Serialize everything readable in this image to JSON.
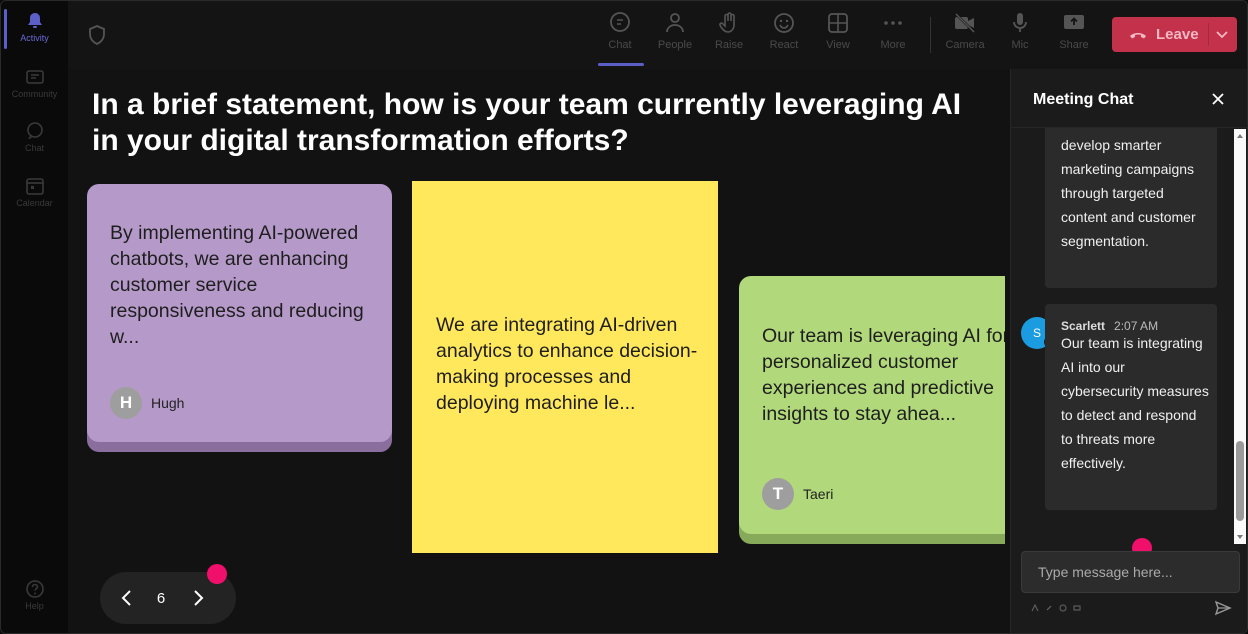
{
  "rail": {
    "items": [
      {
        "label": "Activity",
        "icon": "bell-icon"
      },
      {
        "label": "Community",
        "icon": "community-icon"
      },
      {
        "label": "Chat",
        "icon": "chat-icon"
      },
      {
        "label": "Calendar",
        "icon": "calendar-icon"
      },
      {
        "label": "Help",
        "icon": "help-icon"
      }
    ]
  },
  "toolbar": {
    "chat": "Chat",
    "people": "People",
    "raise": "Raise",
    "react": "React",
    "view": "View",
    "more": "More",
    "camera": "Camera",
    "mic": "Mic",
    "share": "Share",
    "leave": "Leave"
  },
  "question": "In a brief statement, how is your team currently leveraging AI in your digital transformation efforts?",
  "cards": [
    {
      "text": "By implementing AI-powered chatbots, we are enhancing customer service responsiveness and reducing w...",
      "author": "Hugh",
      "initial": "H",
      "color": "#b59ac9"
    },
    {
      "text": "We are integrating AI-driven analytics to enhance decision-making processes and deploying machine le...",
      "color": "#ffe85c"
    },
    {
      "text": "Our team is leveraging AI for personalized customer experiences and predictive insights to stay ahea...",
      "author": "Taeri",
      "initial": "T",
      "color": "#b1d87a"
    }
  ],
  "pager": {
    "page": "6"
  },
  "chat": {
    "title": "Meeting Chat",
    "messages": [
      {
        "text": "develop smarter marketing campaigns through targeted content and customer segmentation."
      },
      {
        "sender": "Scarlett",
        "time": "2:07 AM",
        "initial": "S",
        "text": "Our team is integrating AI into our cybersecurity measures to detect and respond to threats more effectively."
      }
    ],
    "input_placeholder": "Type message here..."
  },
  "colors": {
    "accent": "#5b5fc7",
    "leave": "#c4314b",
    "marker": "#f0106b",
    "avatar_s": "#1b9ce0"
  }
}
